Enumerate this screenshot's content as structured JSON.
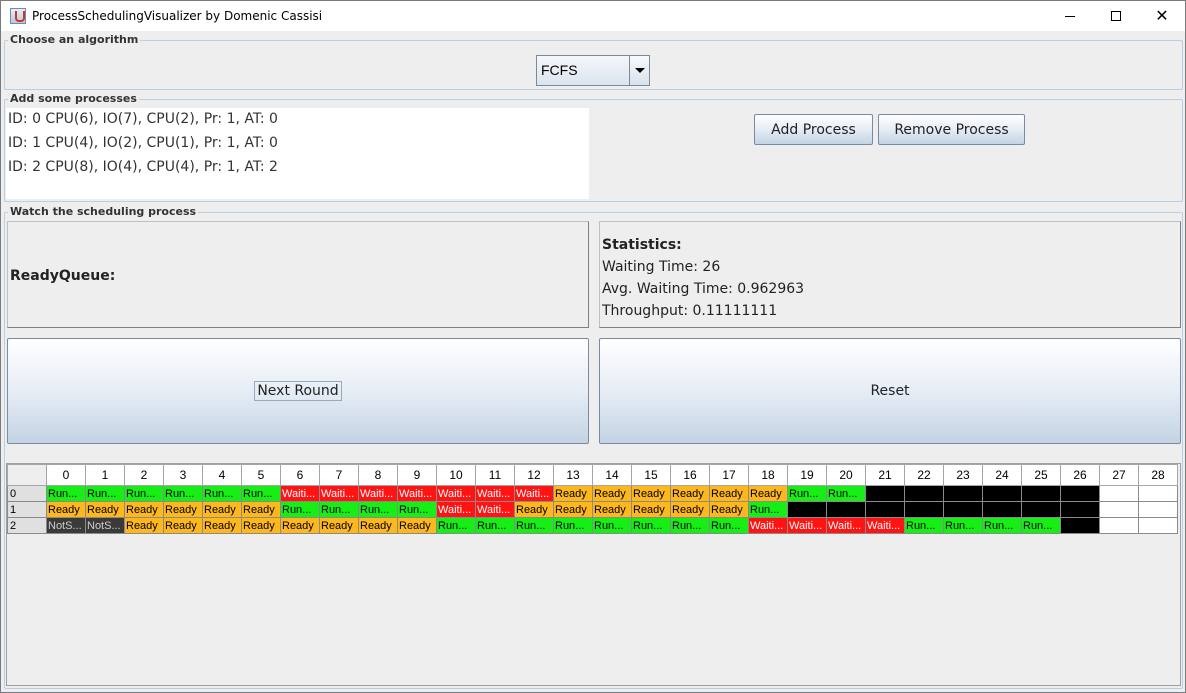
{
  "window": {
    "title": "ProcessSchedulingVisualizer by Domenic Cassisi"
  },
  "algorithm": {
    "group_title": "Choose an algorithm",
    "selected": "FCFS"
  },
  "processes": {
    "group_title": "Add some processes",
    "items": [
      "ID: 0 CPU(6), IO(7), CPU(2), Pr: 1, AT: 0",
      "ID: 1 CPU(4), IO(2), CPU(1), Pr: 1, AT: 0",
      "ID: 2 CPU(8), IO(4), CPU(4), Pr: 1, AT: 2"
    ],
    "add_label": "Add Process",
    "remove_label": "Remove Process"
  },
  "watch": {
    "group_title": "Watch the scheduling process",
    "ready_queue_label": "ReadyQueue:",
    "statistics": {
      "heading": "Statistics:",
      "waiting_time": "Waiting Time: 26",
      "avg_waiting_time": "Avg. Waiting Time: 0.962963",
      "throughput": "Throughput: 0.11111111"
    },
    "next_round_label": "Next Round",
    "reset_label": "Reset"
  },
  "gantt": {
    "columns": [
      "0",
      "1",
      "2",
      "3",
      "4",
      "5",
      "6",
      "7",
      "8",
      "9",
      "10",
      "11",
      "12",
      "13",
      "14",
      "15",
      "16",
      "17",
      "18",
      "19",
      "20",
      "21",
      "22",
      "23",
      "24",
      "25",
      "26",
      "27",
      "28"
    ],
    "rows": [
      {
        "id": "0",
        "cells": [
          "Run...",
          "Run...",
          "Run...",
          "Run...",
          "Run...",
          "Run...",
          "Waiti...",
          "Waiti...",
          "Waiti...",
          "Waiti...",
          "Waiti...",
          "Waiti...",
          "Waiti...",
          "Ready",
          "Ready",
          "Ready",
          "Ready",
          "Ready",
          "Ready",
          "Run...",
          "Run...",
          "",
          "",
          "",
          "",
          "",
          "",
          "",
          ""
        ],
        "states": [
          "run",
          "run",
          "run",
          "run",
          "run",
          "run",
          "wait",
          "wait",
          "wait",
          "wait",
          "wait",
          "wait",
          "wait",
          "ready",
          "ready",
          "ready",
          "ready",
          "ready",
          "ready",
          "run",
          "run",
          "done",
          "done",
          "done",
          "done",
          "done",
          "done",
          "empty",
          "empty"
        ]
      },
      {
        "id": "1",
        "cells": [
          "Ready",
          "Ready",
          "Ready",
          "Ready",
          "Ready",
          "Ready",
          "Run...",
          "Run...",
          "Run...",
          "Run...",
          "Waiti...",
          "Waiti...",
          "Ready",
          "Ready",
          "Ready",
          "Ready",
          "Ready",
          "Ready",
          "Run...",
          "",
          "",
          "",
          "",
          "",
          "",
          "",
          "",
          "",
          ""
        ],
        "states": [
          "ready",
          "ready",
          "ready",
          "ready",
          "ready",
          "ready",
          "run",
          "run",
          "run",
          "run",
          "wait",
          "wait",
          "ready",
          "ready",
          "ready",
          "ready",
          "ready",
          "ready",
          "run",
          "done",
          "done",
          "done",
          "done",
          "done",
          "done",
          "done",
          "done",
          "empty",
          "empty"
        ]
      },
      {
        "id": "2",
        "cells": [
          "NotS...",
          "NotS...",
          "Ready",
          "Ready",
          "Ready",
          "Ready",
          "Ready",
          "Ready",
          "Ready",
          "Ready",
          "Run...",
          "Run...",
          "Run...",
          "Run...",
          "Run...",
          "Run...",
          "Run...",
          "Run...",
          "Waiti...",
          "Waiti...",
          "Waiti...",
          "Waiti...",
          "Run...",
          "Run...",
          "Run...",
          "Run...",
          "",
          "",
          ""
        ],
        "states": [
          "not",
          "not",
          "ready",
          "ready",
          "ready",
          "ready",
          "ready",
          "ready",
          "ready",
          "ready",
          "run",
          "run",
          "run",
          "run",
          "run",
          "run",
          "run",
          "run",
          "wait",
          "wait",
          "wait",
          "wait",
          "run",
          "run",
          "run",
          "run",
          "done",
          "empty",
          "empty"
        ]
      }
    ],
    "colors": {
      "running": "#16ee16",
      "waiting": "#ff1414",
      "ready": "#ffb81c",
      "done": "#000000",
      "not_started": "#3a3a3a"
    }
  }
}
